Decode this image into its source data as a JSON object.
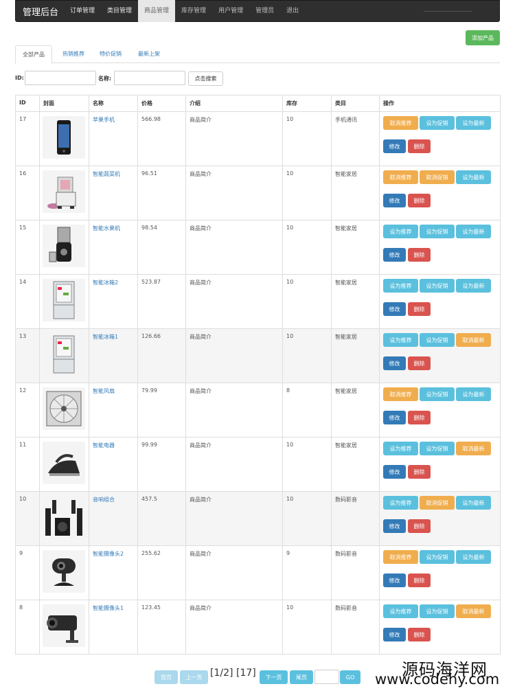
{
  "nav": {
    "brand": "管理后台",
    "items": [
      "订单管理",
      "类目管理",
      "商品管理",
      "库存管理",
      "用户管理",
      "管理员",
      "退出"
    ]
  },
  "toolbar": {
    "add_label": "添加产品"
  },
  "tabs": [
    "全部产品",
    "热销推荐",
    "特价促销",
    "最新上架"
  ],
  "search": {
    "id_label": "ID:",
    "name_label": "名称:",
    "button_label": "点击搜索"
  },
  "table": {
    "headers": [
      "ID",
      "封面",
      "名称",
      "价格",
      "介绍",
      "库存",
      "类目",
      "操作"
    ],
    "rows": [
      {
        "id": "17",
        "name": "苹果手机",
        "price": "566.98",
        "intro": "商品简介",
        "stock": "10",
        "category": "手机通讯",
        "icon": "phone-image",
        "ops": [
          "取消推荐",
          "设为促销",
          "设为最新"
        ],
        "op_active": [
          true,
          false,
          false
        ]
      },
      {
        "id": "16",
        "name": "智能蔬菜机",
        "price": "96.51",
        "intro": "商品简介",
        "stock": "10",
        "category": "智能家居",
        "icon": "blender-image",
        "ops": [
          "取消推荐",
          "取消促销",
          "设为最新"
        ],
        "op_active": [
          true,
          true,
          false
        ]
      },
      {
        "id": "15",
        "name": "智能水果机",
        "price": "98.54",
        "intro": "商品简介",
        "stock": "10",
        "category": "智能家居",
        "icon": "juicer-image",
        "ops": [
          "设为推荐",
          "设为促销",
          "设为最新"
        ],
        "op_active": [
          false,
          false,
          false
        ]
      },
      {
        "id": "14",
        "name": "智能冰箱2",
        "price": "523.87",
        "intro": "商品简介",
        "stock": "10",
        "category": "智能家居",
        "icon": "fridge-image",
        "ops": [
          "设为推荐",
          "设为促销",
          "设为最新"
        ],
        "op_active": [
          false,
          false,
          false
        ]
      },
      {
        "id": "13",
        "name": "智能冰箱1",
        "price": "126.66",
        "intro": "商品简介",
        "stock": "10",
        "category": "智能家居",
        "icon": "fridge-image",
        "ops": [
          "设为推荐",
          "设为促销",
          "取消最新"
        ],
        "op_active": [
          false,
          false,
          true
        ]
      },
      {
        "id": "12",
        "name": "智能风扇",
        "price": "79.99",
        "intro": "商品简介",
        "stock": "8",
        "category": "智能家居",
        "icon": "fan-image",
        "ops": [
          "取消推荐",
          "设为促销",
          "设为最新"
        ],
        "op_active": [
          true,
          false,
          false
        ]
      },
      {
        "id": "11",
        "name": "智能电器",
        "price": "99.99",
        "intro": "商品简介",
        "stock": "10",
        "category": "智能家居",
        "icon": "iron-image",
        "ops": [
          "设为推荐",
          "设为促销",
          "取消最新"
        ],
        "op_active": [
          false,
          false,
          true
        ]
      },
      {
        "id": "10",
        "name": "音响组合",
        "price": "457.5",
        "intro": "商品简介",
        "stock": "10",
        "category": "数码影音",
        "icon": "speaker-image",
        "ops": [
          "设为推荐",
          "取消促销",
          "设为最新"
        ],
        "op_active": [
          false,
          true,
          false
        ]
      },
      {
        "id": "9",
        "name": "智能摄像头2",
        "price": "255.62",
        "intro": "商品简介",
        "stock": "9",
        "category": "数码影音",
        "icon": "webcam-image",
        "ops": [
          "取消推荐",
          "设为促销",
          "设为最新"
        ],
        "op_active": [
          true,
          false,
          false
        ]
      },
      {
        "id": "8",
        "name": "智能摄像头1",
        "price": "123.45",
        "intro": "商品简介",
        "stock": "10",
        "category": "数码影音",
        "icon": "camera-image",
        "ops": [
          "设为推荐",
          "设为促销",
          "取消最新"
        ],
        "op_active": [
          false,
          false,
          true
        ]
      }
    ],
    "edit_label": "修改",
    "delete_label": "删除"
  },
  "pagination": {
    "first": "首页",
    "prev": "上一页",
    "page_info": "[1/2]",
    "total": "[17]",
    "next": "下一页",
    "last": "尾页",
    "go": "GO"
  },
  "watermark": {
    "line1": "源码海洋网",
    "line2": "www.codehy.com"
  },
  "colors": {
    "nav_bg": "#2f2f2f",
    "success": "#5cb85c",
    "info": "#5bc0de",
    "warning": "#f0ad4e",
    "primary": "#337ab7",
    "danger": "#d9534f"
  }
}
